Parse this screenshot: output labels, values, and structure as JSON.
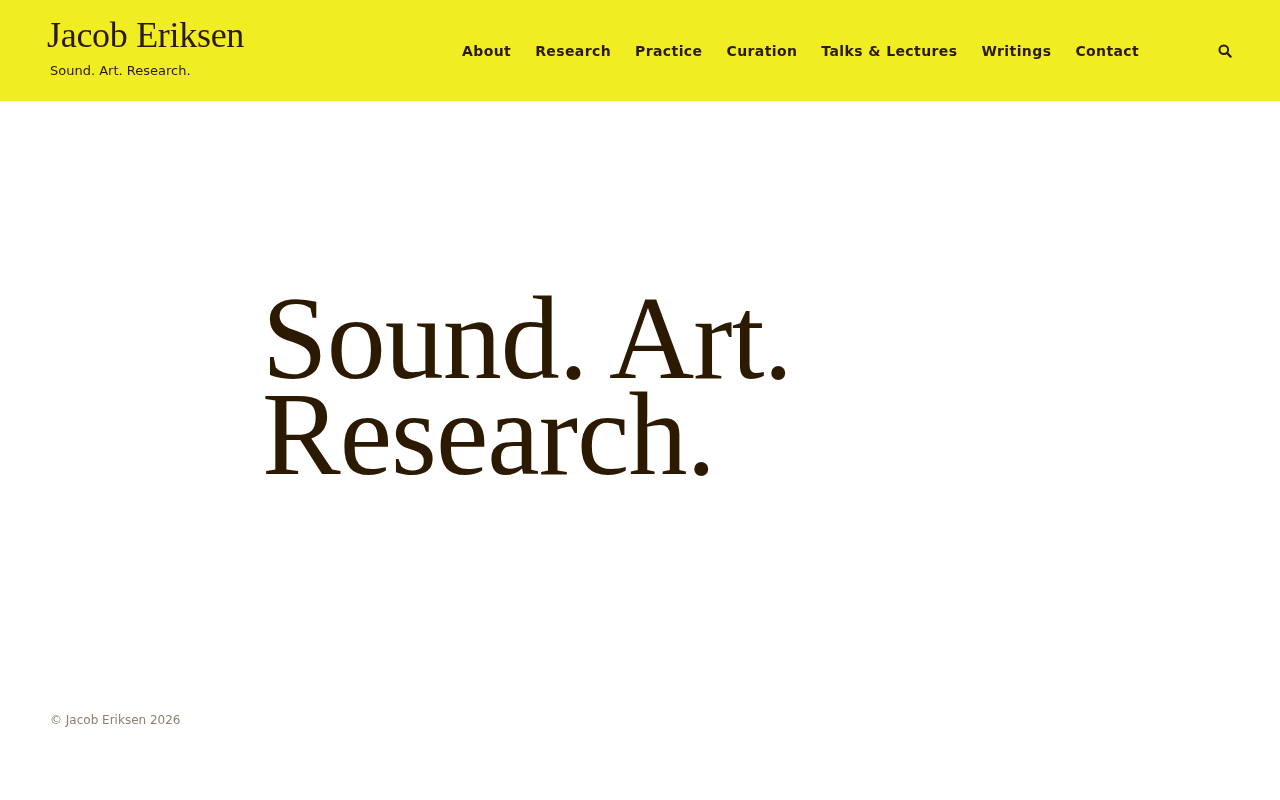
{
  "header": {
    "site_title": "Jacob Eriksen",
    "tagline": "Sound. Art. Research.",
    "nav": [
      {
        "label": "About"
      },
      {
        "label": "Research"
      },
      {
        "label": "Practice"
      },
      {
        "label": "Curation"
      },
      {
        "label": "Talks & Lectures"
      },
      {
        "label": "Writings"
      },
      {
        "label": "Contact"
      }
    ]
  },
  "hero": {
    "lines": [
      "Sound. Art.",
      "Research."
    ]
  },
  "footer": {
    "copyright": "© Jacob Eriksen 2026"
  }
}
